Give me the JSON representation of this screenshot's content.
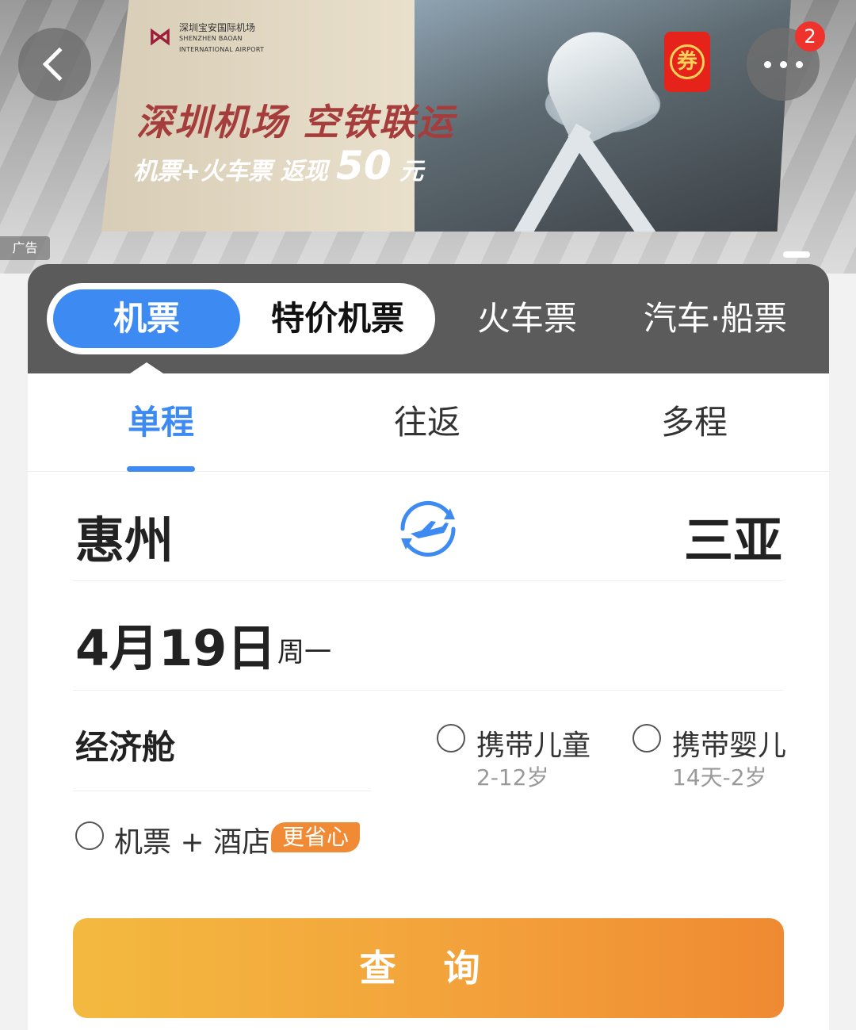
{
  "banner": {
    "ad_logo_cn": "深圳宝安国际机场",
    "ad_logo_en_1": "SHENZHEN BAOAN",
    "ad_logo_en_2": "INTERNATIONAL AIRPORT",
    "ad_headline": "深圳机场 空铁联运",
    "ad_sub_prefix": "机票+火车票 返现",
    "ad_sub_amount": "50",
    "ad_sub_unit": "元",
    "ad_tag": "广告",
    "coupon_label": "券",
    "more_badge_count": "2"
  },
  "category_tabs": {
    "active": "机票",
    "second": "特价机票",
    "train": "火车票",
    "bus_ship": "汽车·船票"
  },
  "trip_tabs": [
    {
      "label": "单程",
      "active": true
    },
    {
      "label": "往返",
      "active": false
    },
    {
      "label": "多程",
      "active": false
    }
  ],
  "route": {
    "from": "惠州",
    "to": "三亚"
  },
  "date": {
    "main": "4月19日",
    "weekday": "周一"
  },
  "cabin": {
    "label": "经济舱",
    "child": {
      "label": "携带儿童",
      "sub": "2-12岁",
      "checked": false
    },
    "infant": {
      "label": "携带婴儿",
      "sub": "14天-2岁",
      "checked": false
    }
  },
  "hotel_combo": {
    "label": "机票 + 酒店",
    "badge": "更省心",
    "checked": false
  },
  "search_button": "查 询",
  "colors": {
    "accent_blue": "#3d8bf2",
    "search_gradient_start": "#f3b93f",
    "search_gradient_end": "#ef8a32",
    "tabbar_bg": "#5b5b5b"
  }
}
